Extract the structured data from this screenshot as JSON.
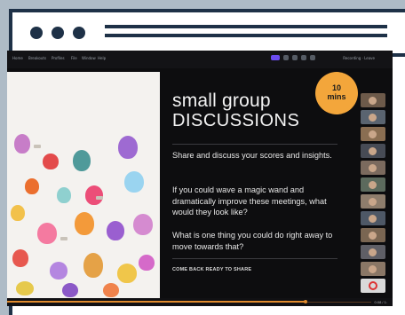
{
  "browser": {
    "dots": [
      "dot-1",
      "dot-2",
      "dot-3"
    ]
  },
  "app": {
    "menu": [
      "Home",
      "Breakouts",
      "Profiles",
      "File",
      "Window",
      "Help"
    ],
    "menu_right": "Recording  ·  Leave"
  },
  "slide": {
    "title_line1": "small group",
    "title_line2": "DISCUSSIONS",
    "badge_line1": "10",
    "badge_line2": "mins",
    "paragraph1": "Share and discuss your scores and insights.",
    "paragraph2": "If you could wave a magic wand and dramatically improve these meetings, what would they look like?",
    "paragraph3": "What is one thing you could do right away to move towards that?",
    "cta": "COME BACK READY TO SHARE"
  },
  "playback": {
    "time": "0:08 / 1:",
    "progress": 0.82
  },
  "colors": {
    "frame": "#1e3147",
    "badge": "#f3a63b",
    "progress": "#e08b2d"
  }
}
